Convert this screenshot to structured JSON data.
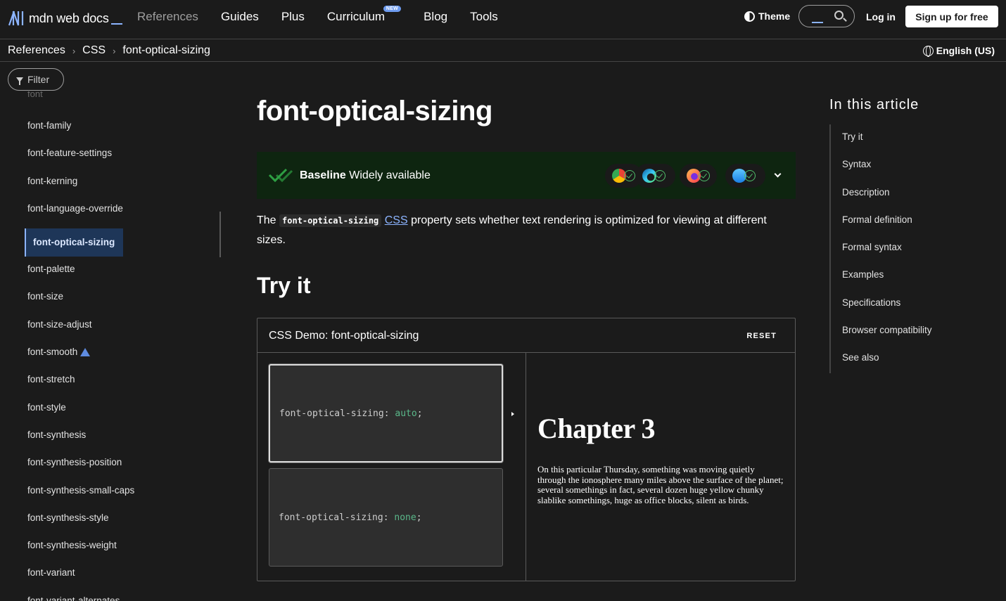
{
  "header": {
    "logo_text": "mdn web docs",
    "nav": [
      {
        "label": "References",
        "dim": true
      },
      {
        "label": "Guides"
      },
      {
        "label": "Plus"
      },
      {
        "label": "Curriculum",
        "badge": "NEW"
      },
      {
        "label": "Blog"
      },
      {
        "label": "Tools"
      }
    ],
    "theme_label": "Theme",
    "login_label": "Log in",
    "signup_label": "Sign up for free"
  },
  "breadcrumb": {
    "items": [
      "References",
      "CSS",
      "font-optical-sizing"
    ],
    "language": "English (US)"
  },
  "sidebar": {
    "filter_label": "Filter",
    "cut_item": "font",
    "items": [
      "font-family",
      "font-feature-settings",
      "font-kerning",
      "font-language-override",
      "font-optical-sizing",
      "font-palette",
      "font-size",
      "font-size-adjust",
      "font-smooth",
      "font-stretch",
      "font-style",
      "font-synthesis",
      "font-synthesis-position",
      "font-synthesis-small-caps",
      "font-synthesis-style",
      "font-synthesis-weight",
      "font-variant",
      "font-variant-alternates"
    ],
    "active_index": 4,
    "warning_index": 8
  },
  "main": {
    "title": "font-optical-sizing",
    "baseline": {
      "bold": "Baseline",
      "text": " Widely available",
      "browsers": [
        "chrome-icon",
        "edge-icon",
        "firefox-icon",
        "safari-icon"
      ]
    },
    "intro": {
      "before": "The ",
      "code": "font-optical-sizing",
      "link": "CSS",
      "after": " property sets whether text rendering is optimized for viewing at different sizes."
    },
    "tryit_heading": "Try it",
    "demo": {
      "title": "CSS Demo: font-optical-sizing",
      "reset": "RESET",
      "options": [
        {
          "prop": "font-optical-sizing",
          "value": "auto",
          "selected": true
        },
        {
          "prop": "font-optical-sizing",
          "value": "none",
          "selected": false
        }
      ],
      "output_heading": "Chapter 3",
      "output_text": "On this particular Thursday, something was moving quietly through the ionosphere many miles above the surface of the planet; several somethings in fact, several dozen huge yellow chunky slablike somethings, huge as office blocks, silent as birds."
    }
  },
  "toc": {
    "title": "In this article",
    "items": [
      "Try it",
      "Syntax",
      "Description",
      "Formal definition",
      "Formal syntax",
      "Examples",
      "Specifications",
      "Browser compatibility",
      "See also"
    ]
  }
}
